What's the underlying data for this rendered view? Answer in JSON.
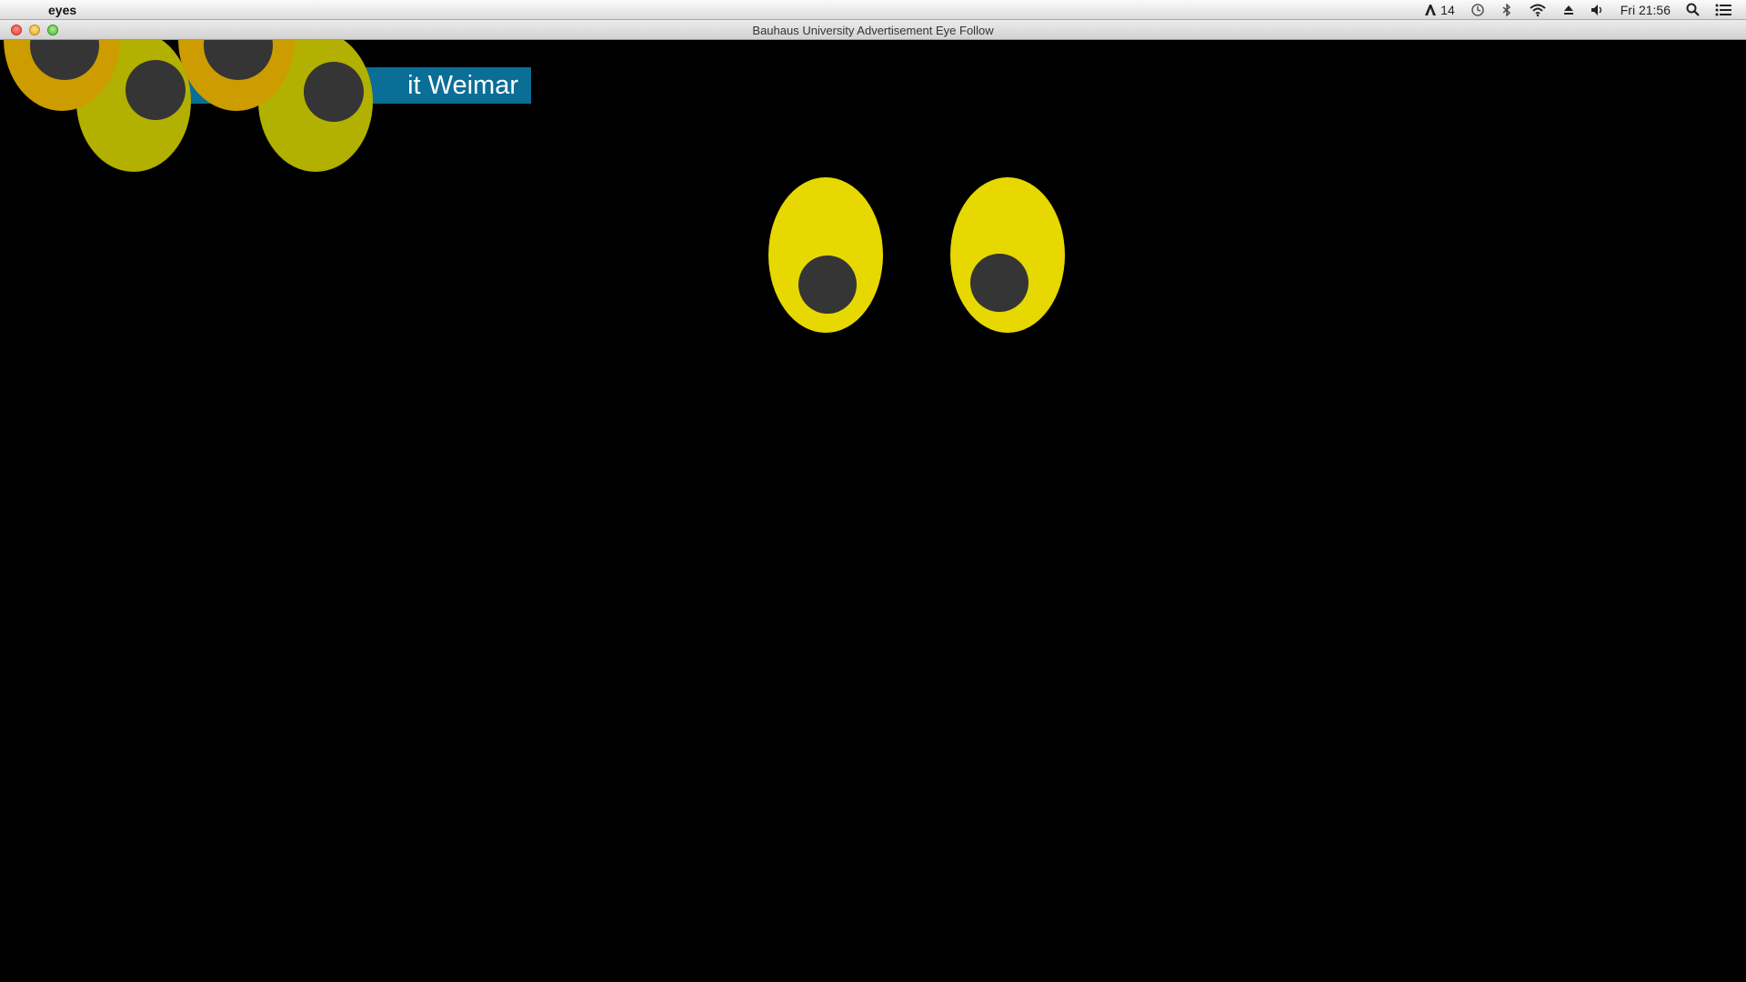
{
  "menubar": {
    "apple_icon": "",
    "app_name": "eyes",
    "status": {
      "adobe_icon": "Ai",
      "adobe_count": "14",
      "time_machine_icon": "◷",
      "clock": "Fri 21:56"
    }
  },
  "window": {
    "title": "Bauhaus University Advertisement Eye Follow"
  },
  "content": {
    "banner_text": "it Weimar",
    "colors": {
      "background": "#000000",
      "banner": "#0b6e96",
      "eye_main": "#e6d800",
      "eye_olive": "#b2b000",
      "eye_orange": "#cc9c00",
      "pupil": "#353535"
    }
  }
}
